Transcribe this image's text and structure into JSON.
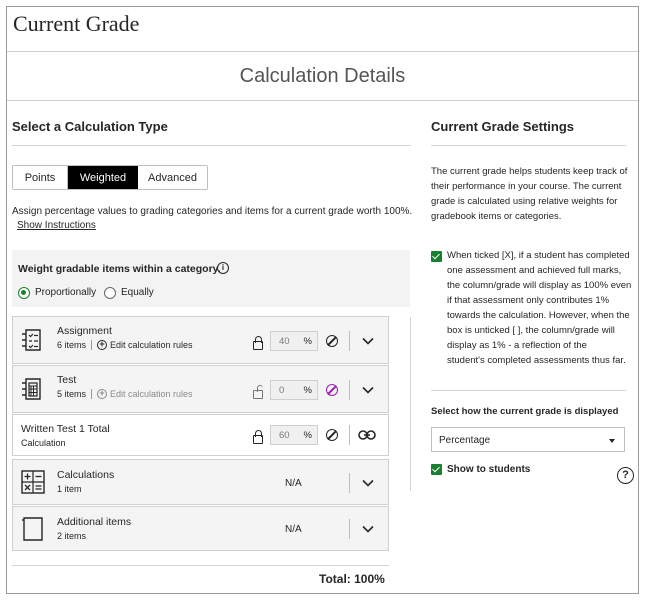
{
  "header": {
    "title": "Current Grade"
  },
  "details": {
    "title": "Calculation Details"
  },
  "calc_type": {
    "heading": "Select a Calculation Type",
    "tabs": [
      {
        "label": "Points",
        "selected": false
      },
      {
        "label": "Weighted",
        "selected": true
      },
      {
        "label": "Advanced",
        "selected": false
      }
    ],
    "description": "Assign percentage values to grading categories and items for a current grade worth 100%.",
    "show_instructions": "Show Instructions"
  },
  "weight_option": {
    "label": "Weight gradable items within a category.",
    "info_icon": "info-icon",
    "options": [
      {
        "label": "Proportionally",
        "selected": true
      },
      {
        "label": "Equally",
        "selected": false
      }
    ]
  },
  "categories": [
    {
      "name": "Assignment",
      "count": "6 items",
      "edit_label": "Edit calculation rules",
      "weight": "40",
      "unit": "%",
      "locked": true,
      "icon": "assignment-icon"
    },
    {
      "name": "Test",
      "count": "5 items",
      "edit_label": "Edit calculation rules",
      "weight": "0",
      "unit": "%",
      "locked": false,
      "icon": "test-icon"
    },
    {
      "name": "Written Test 1 Total",
      "count": "Calculation",
      "weight": "60",
      "unit": "%",
      "locked": true,
      "icon": "link-icon"
    },
    {
      "name": "Calculations",
      "count": "1 item",
      "weight": "N/A",
      "icon": "calculator-icon"
    },
    {
      "name": "Additional items",
      "count": "2 items",
      "weight": "N/A",
      "icon": "page-icon"
    }
  ],
  "total": "Total: 100%",
  "settings": {
    "heading": "Current Grade Settings",
    "description": "The current grade helps students keep track of their performance in your course. The current grade is calculated using relative weights for gradebook items or categories.",
    "tick_text": "When ticked [X], if a student has completed one assessment and achieved full marks, the column/grade will display as 100% even if that assessment only contributes 1% towards the calculation. However, when the box is unticked [ ], the column/grade will display as 1% - a reflection of the\nstudent's completed assessments thus far.",
    "tick_checked": true,
    "display_label": "Select how the current grade is displayed",
    "display_value": "Percentage",
    "show_students": "Show to students",
    "show_students_checked": true
  },
  "colors": {
    "accent_green": "#19802f",
    "exclude_purple": "#9b1fb0",
    "tab_selected_bg": "#000000"
  }
}
